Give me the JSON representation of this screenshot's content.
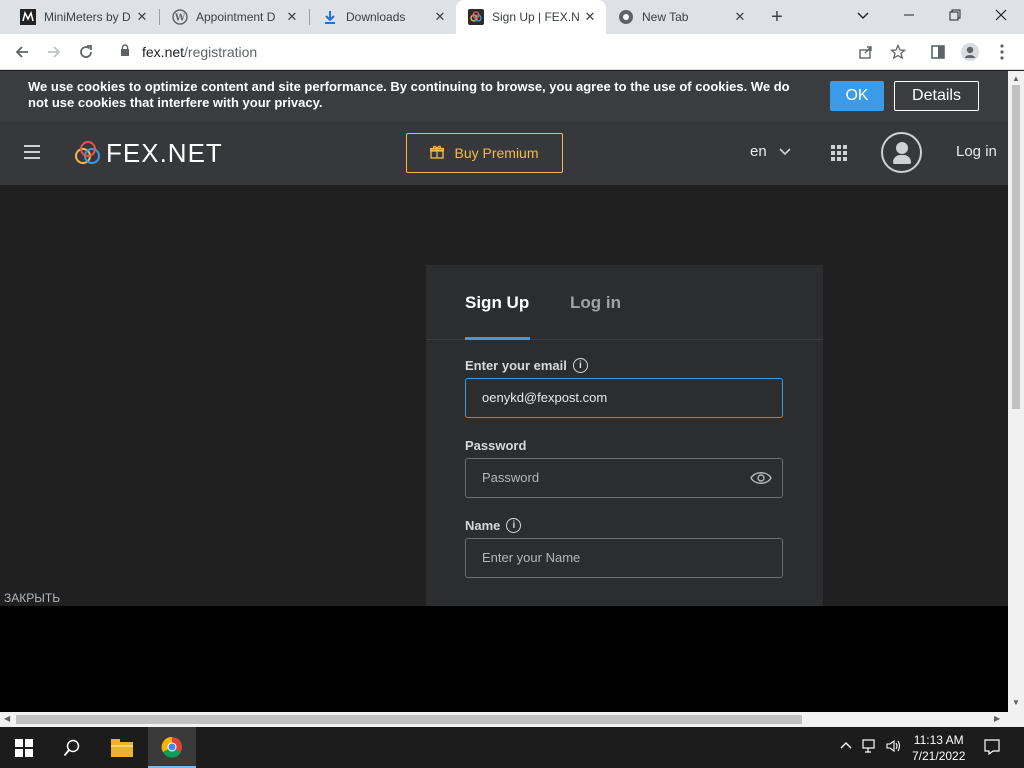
{
  "browser": {
    "tabs": [
      {
        "title": "MiniMeters by D",
        "favicon": "minimeters-icon"
      },
      {
        "title": "Appointment D",
        "favicon": "wordpress-icon"
      },
      {
        "title": "Downloads",
        "favicon": "download-icon"
      },
      {
        "title": "Sign Up | FEX.N",
        "favicon": "fex-icon",
        "active": true
      },
      {
        "title": "New Tab",
        "favicon": "chrome-icon"
      }
    ],
    "url_host": "fex.net",
    "url_path": "/registration"
  },
  "cookie_banner": {
    "text": "We use cookies to optimize content and site performance. By continuing to browse, you agree to the use of cookies. We do not use cookies that interfere with your privacy.",
    "ok_label": "OK",
    "details_label": "Details"
  },
  "header": {
    "logo_text": "FEX.NET",
    "premium_label": "Buy Premium",
    "language": "en",
    "login_label": "Log in"
  },
  "form": {
    "tab_signup": "Sign Up",
    "tab_login": "Log in",
    "email_label": "Enter your email",
    "email_value": "oenykd@fexpost.com",
    "password_label": "Password",
    "password_placeholder": "Password",
    "name_label": "Name",
    "name_placeholder": "Enter your Name"
  },
  "overlay": {
    "close_label": "ЗАКРЫТЬ"
  },
  "taskbar": {
    "time": "11:13 AM",
    "date": "7/21/2022"
  },
  "colors": {
    "accent": "#3b9be8",
    "premium": "#f4bc4a"
  }
}
